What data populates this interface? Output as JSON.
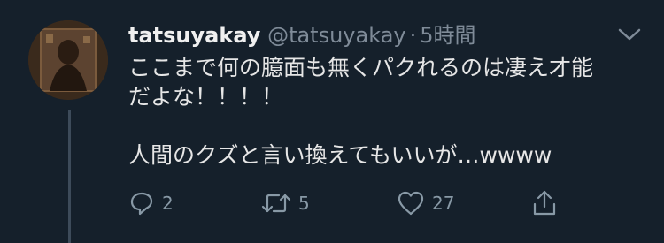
{
  "user": {
    "display_name": "tatsuyakay",
    "handle": "@tatsuyakay",
    "separator": "·",
    "time": "5時間"
  },
  "tweet": {
    "text": "ここまで何の臆面も無くパクれるのは凄え才能\nだよな！！！！\n\n人間のクズと言い換えてもいいが…wwww"
  },
  "actions": {
    "reply": {
      "icon": "reply-icon",
      "count": "2"
    },
    "retweet": {
      "icon": "retweet-icon",
      "count": "5"
    },
    "like": {
      "icon": "heart-icon",
      "count": "27"
    },
    "share": {
      "icon": "share-icon"
    }
  },
  "colors": {
    "background": "#15202b",
    "muted": "#8899a6",
    "text": "#e6e6e6"
  }
}
